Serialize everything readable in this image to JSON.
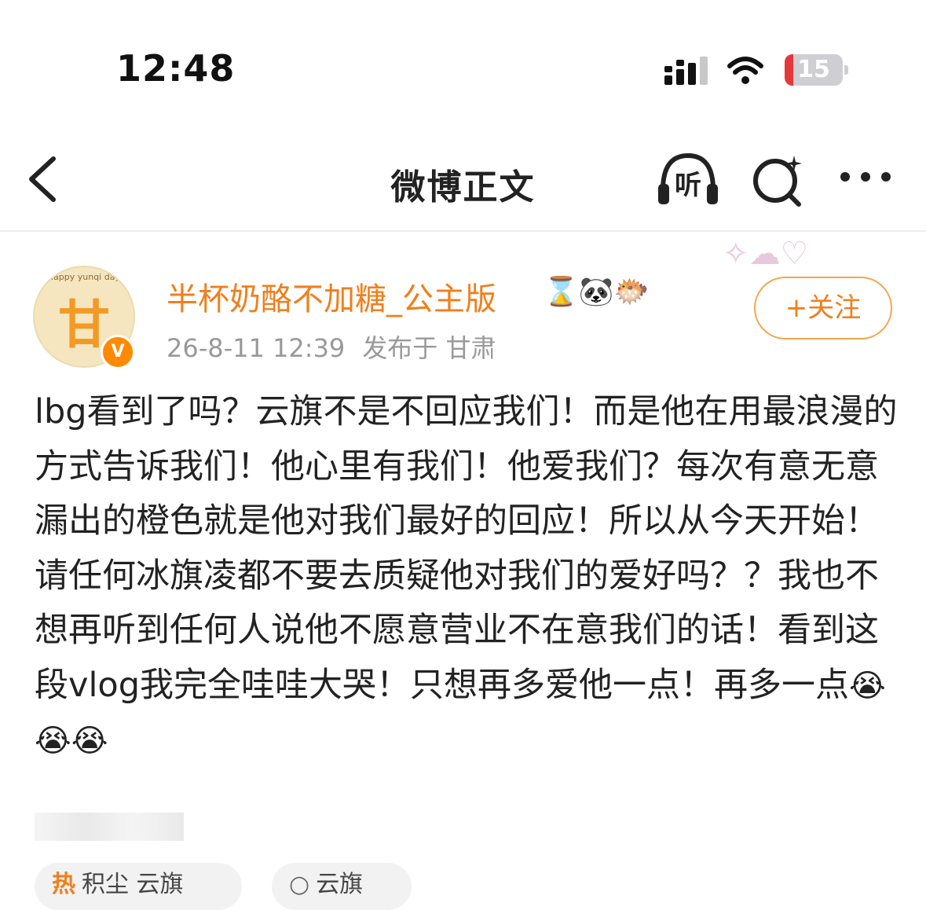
{
  "status_bar": {
    "time": "12:48",
    "battery_level": "15"
  },
  "nav": {
    "title": "微博正文",
    "listen_label": "听"
  },
  "post": {
    "username": "半杯奶酪不加糖_公主版",
    "badges": "⌛🐼🐡",
    "avatar_char": "甘",
    "avatar_deco": "happy yunqi day",
    "verified_mark": "V",
    "timestamp": "26-8-11 12:39",
    "location": "发布于 甘肃",
    "follow_label": "+关注",
    "body_text": "lbg看到了吗？云旗不是不回应我们！而是他在用最浪漫的方式告诉我们！他心里有我们！他爱我们？每次有意无意漏出的橙色就是他对我们最好的回应！所以从今天开始！请任何冰旗凌都不要去质疑他对我们的爱好吗？？我也不想再听到任何人说他不愿意营业不在意我们的话！看到这段vlog我完全哇哇大哭！只想再多爱他一点！再多一点",
    "body_emojis": "😭😭😭"
  },
  "tags": [
    {
      "icon": "热",
      "label": "积尘 云旗"
    },
    {
      "icon": "○",
      "label": "云旗"
    }
  ],
  "colors": {
    "accent": "#f07f1c",
    "meta_gray": "#999999"
  }
}
